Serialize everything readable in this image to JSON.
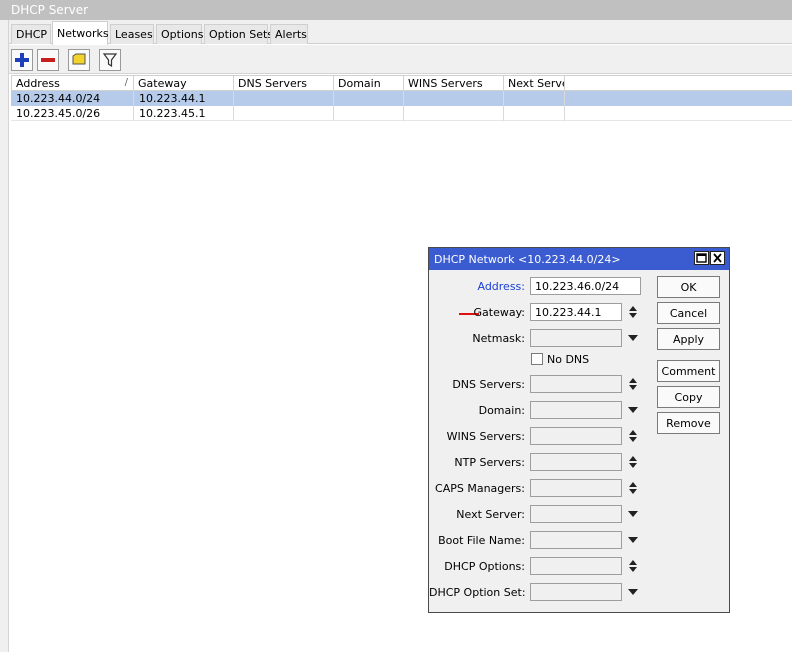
{
  "window": {
    "title": "DHCP Server"
  },
  "tabs": [
    "DHCP",
    "Networks",
    "Leases",
    "Options",
    "Option Sets",
    "Alerts"
  ],
  "active_tab": "Networks",
  "table": {
    "columns": [
      "Address",
      "Gateway",
      "DNS Servers",
      "Domain",
      "WINS Servers",
      "Next Server"
    ],
    "sort_indicator": "/",
    "rows": [
      {
        "address": "10.223.44.0/24",
        "gateway": "10.223.44.1",
        "selected": true
      },
      {
        "address": "10.223.45.0/26",
        "gateway": "10.223.45.1",
        "selected": false
      }
    ]
  },
  "dialog": {
    "title": "DHCP Network <10.223.44.0/24>",
    "fields": {
      "address": {
        "label": "Address:",
        "value": "10.223.46.0/24"
      },
      "gateway": {
        "label": "Gateway:",
        "value": "10.223.44.1"
      },
      "netmask": {
        "label": "Netmask:",
        "value": ""
      },
      "no_dns": {
        "label": "No DNS",
        "checked": false
      },
      "dns_servers": {
        "label": "DNS Servers:",
        "value": ""
      },
      "domain": {
        "label": "Domain:",
        "value": ""
      },
      "wins_servers": {
        "label": "WINS Servers:",
        "value": ""
      },
      "ntp_servers": {
        "label": "NTP Servers:",
        "value": ""
      },
      "caps_managers": {
        "label": "CAPS Managers:",
        "value": ""
      },
      "next_server": {
        "label": "Next Server:",
        "value": ""
      },
      "boot_file_name": {
        "label": "Boot File Name:",
        "value": ""
      },
      "dhcp_options": {
        "label": "DHCP Options:",
        "value": ""
      },
      "dhcp_option_set": {
        "label": "DHCP Option Set:",
        "value": ""
      }
    },
    "buttons": {
      "ok": "OK",
      "cancel": "Cancel",
      "apply": "Apply",
      "comment": "Comment",
      "copy": "Copy",
      "remove": "Remove"
    }
  },
  "colors": {
    "dialog_titlebar": "#3b5bd1",
    "selected_row": "#b6cbea",
    "address_label": "#1a3fd6",
    "annotation_mark": "#e01010",
    "add_icon": "#1f3fb8",
    "remove_icon": "#c81e1e"
  },
  "icons": [
    "add-icon",
    "remove-icon",
    "comment-icon",
    "filter-icon",
    "spin-arrows-icon",
    "dropdown-arrow-icon",
    "maximize-icon",
    "close-icon"
  ]
}
